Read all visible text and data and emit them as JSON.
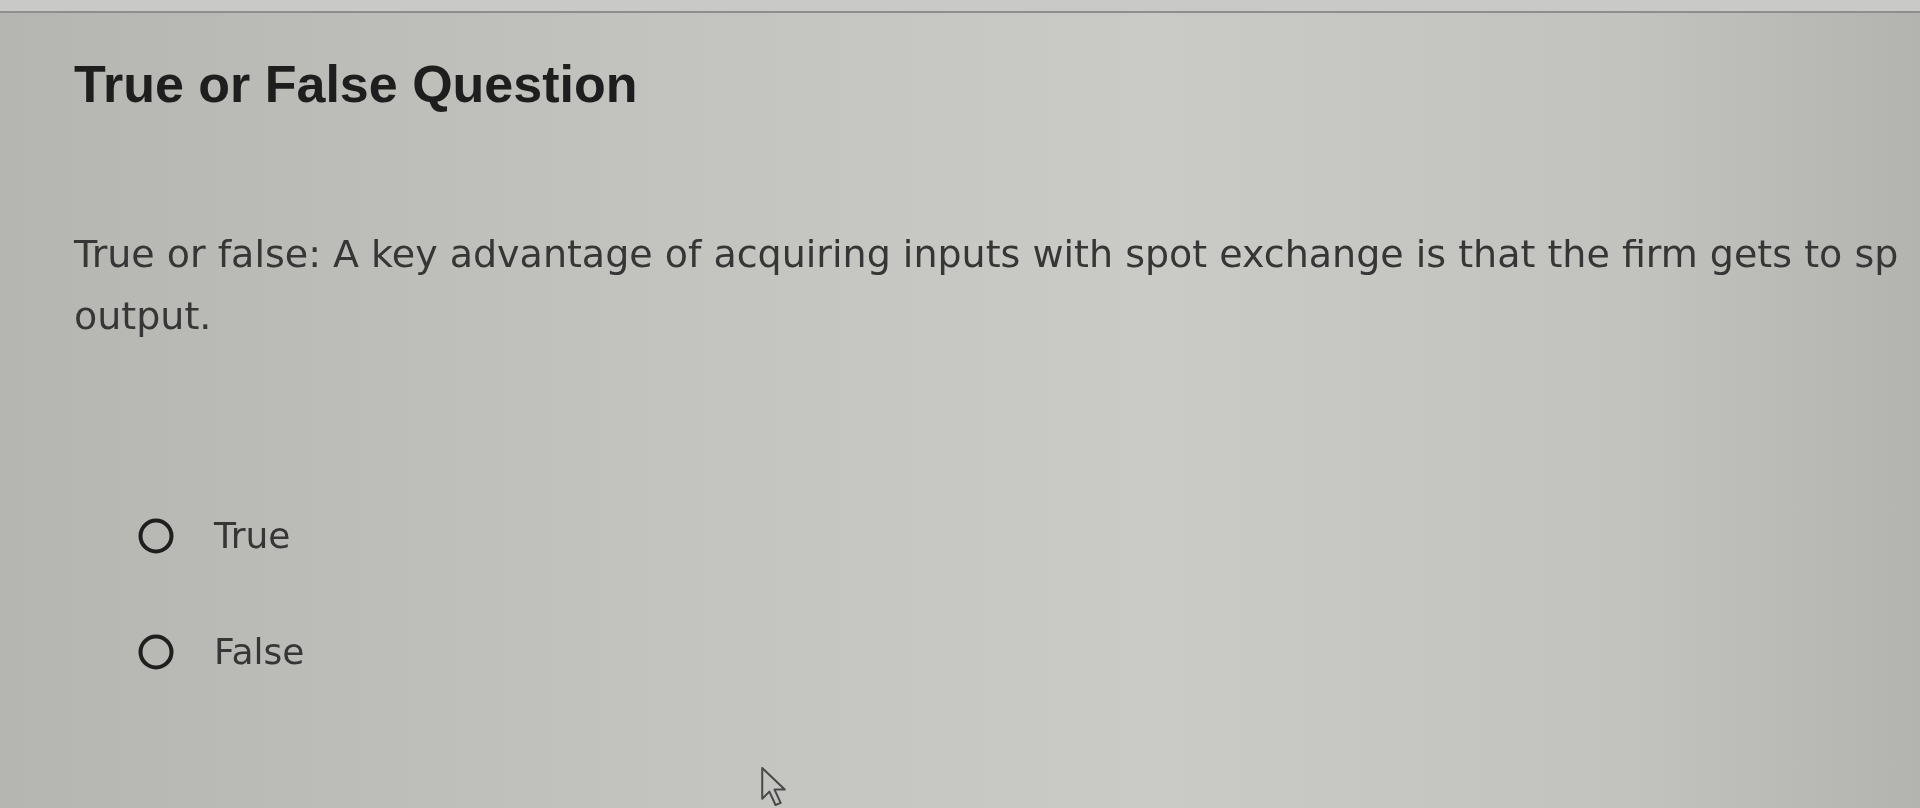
{
  "title": "True or False Question",
  "question": {
    "lines": [
      "True or false: A key advantage of acquiring inputs with spot exchange is that the firm gets to sp",
      "output."
    ]
  },
  "options": [
    {
      "label": "True",
      "selected": false
    },
    {
      "label": "False",
      "selected": false
    }
  ]
}
